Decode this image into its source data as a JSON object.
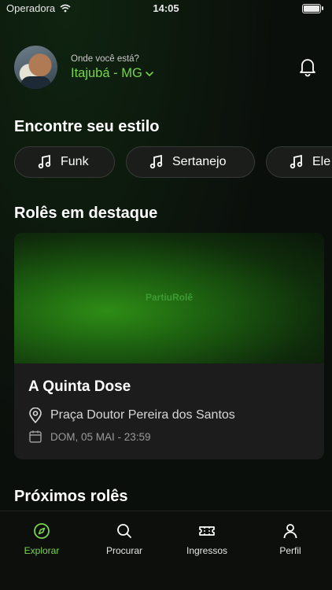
{
  "status_bar": {
    "carrier": "Operadora",
    "time": "14:05"
  },
  "header": {
    "location_label": "Onde você está?",
    "location_value": "Itajubá - MG"
  },
  "styles_section": {
    "title": "Encontre seu estilo",
    "chips": [
      {
        "label": "Funk"
      },
      {
        "label": "Sertanejo"
      },
      {
        "label": "Ele"
      }
    ]
  },
  "featured_section": {
    "title": "Rolês em destaque",
    "card": {
      "brand": "PartiuRolê",
      "title": "A Quinta Dose",
      "place": "Praça Doutor Pereira dos Santos",
      "date": "DOM, 05 MAI - 23:59"
    }
  },
  "upcoming_section": {
    "title": "Próximos rolês"
  },
  "tabbar": {
    "tabs": [
      {
        "label": "Explorar",
        "icon": "compass-icon",
        "active": true
      },
      {
        "label": "Procurar",
        "icon": "search-icon"
      },
      {
        "label": "Ingressos",
        "icon": "ticket-icon"
      },
      {
        "label": "Perfil",
        "icon": "user-icon"
      }
    ]
  },
  "colors": {
    "accent": "#79d44b",
    "background": "#0b0f0b",
    "card": "#1b1c1b"
  }
}
